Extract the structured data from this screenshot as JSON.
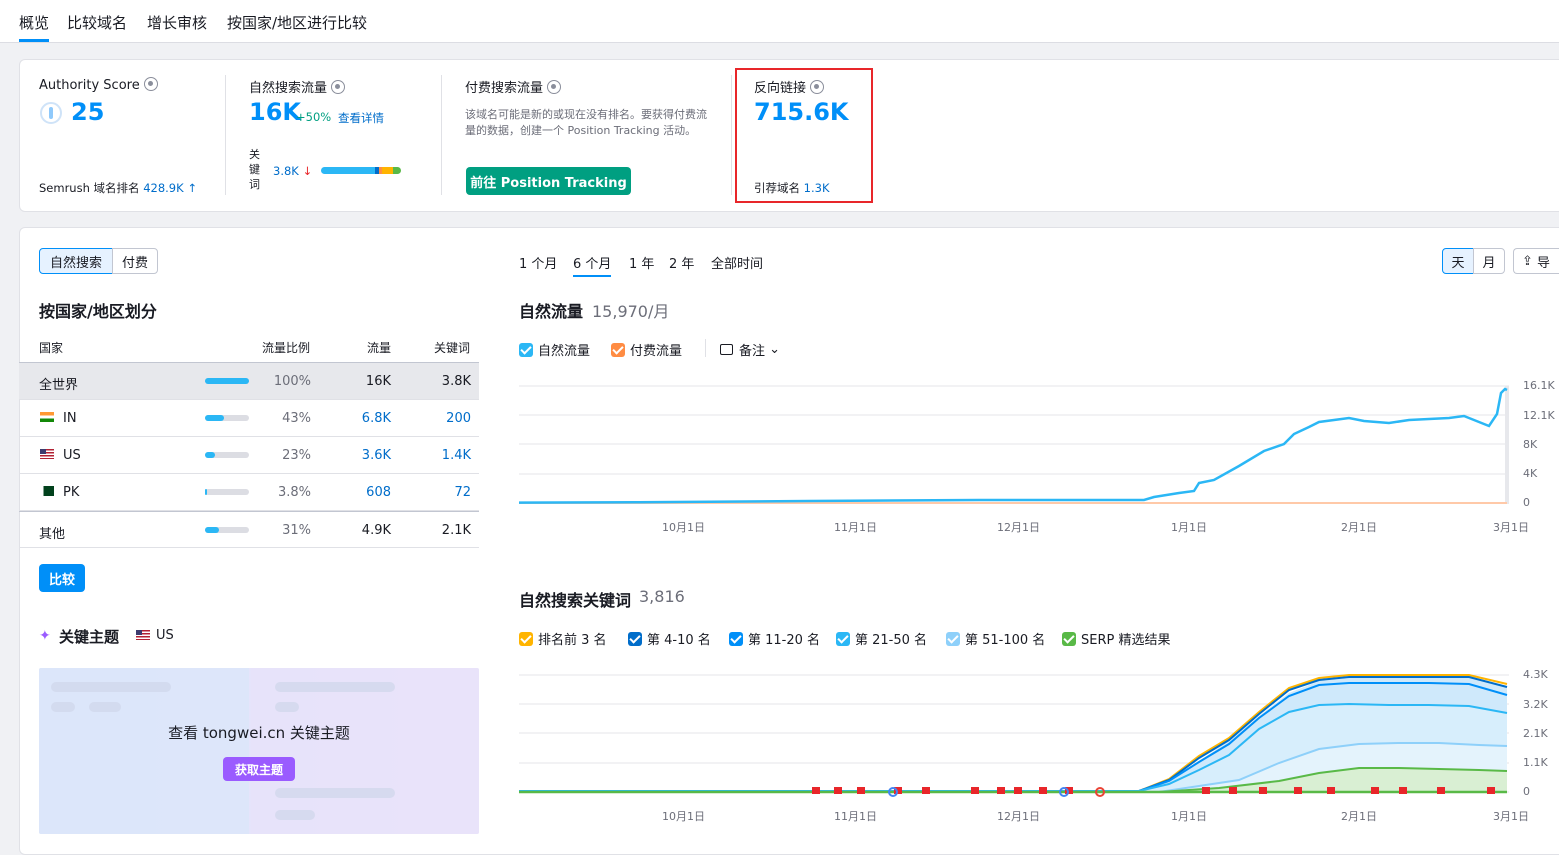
{
  "tabs": [
    "概览",
    "比较域名",
    "增长审核",
    "按国家/地区进行比较"
  ],
  "metrics": {
    "authority": {
      "label": "Authority Score",
      "value": "25",
      "rank_label": "Semrush 域名排名",
      "rank_value": "428.9K",
      "rank_arrow": "↑"
    },
    "organic": {
      "label": "自然搜索流量",
      "value": "16K",
      "change": "+50%",
      "details_link": "查看详情",
      "keywords_label": "关键词",
      "keywords_value": "3.8K",
      "keywords_arrow": "↓"
    },
    "paid": {
      "label": "付费搜索流量",
      "description": "该域名可能是新的或现在没有排名。要获得付费流量的数据，创建一个 Position Tracking 活动。",
      "button": "前往 Position Tracking"
    },
    "backlinks": {
      "label": "反向链接",
      "value": "715.6K",
      "ref_label": "引荐域名",
      "ref_value": "1.3K"
    }
  },
  "toggle": {
    "organic": "自然搜索",
    "paid": "付费"
  },
  "country_section": {
    "title": "按国家/地区划分",
    "headers": [
      "国家",
      "流量比例",
      "流量",
      "关键词"
    ],
    "rows": [
      {
        "country": "全世界",
        "share": "100%",
        "share_fraction": 1.0,
        "traffic": "16K",
        "keywords": "3.8K"
      },
      {
        "country": "IN",
        "share": "43%",
        "share_fraction": 0.43,
        "traffic": "6.8K",
        "keywords": "200"
      },
      {
        "country": "US",
        "share": "23%",
        "share_fraction": 0.23,
        "traffic": "3.6K",
        "keywords": "1.4K"
      },
      {
        "country": "PK",
        "share": "3.8%",
        "share_fraction": 0.038,
        "traffic": "608",
        "keywords": "72"
      },
      {
        "country": "其他",
        "share": "31%",
        "share_fraction": 0.31,
        "traffic": "4.9K",
        "keywords": "2.1K"
      }
    ],
    "compare_button": "比较"
  },
  "topics": {
    "title": "关键主题",
    "country": "US",
    "cta_text": "查看 tongwei.cn 关键主题",
    "cta_button": "获取主题"
  },
  "periods": [
    "1 个月",
    "6 个月",
    "1 年",
    "2 年",
    "全部时间"
  ],
  "granularity": {
    "day": "天",
    "month": "月",
    "export": "导"
  },
  "traffic_chart": {
    "title": "自然流量",
    "subtitle": "15,970/月",
    "legend": [
      {
        "label": "自然流量",
        "color": "#2bb7f5"
      },
      {
        "label": "付费流量",
        "color": "#ff8c43"
      }
    ],
    "notes": "备注",
    "y_ticks": [
      "16.1K",
      "12.1K",
      "8K",
      "4K",
      "0"
    ],
    "x_ticks": [
      "10月1日",
      "11月1日",
      "12月1日",
      "1月1日",
      "2月1日",
      "3月1日"
    ]
  },
  "keywords_chart": {
    "title": "自然搜索关键词",
    "subtitle": "3,816",
    "legend": [
      {
        "label": "排名前 3 名",
        "color": "#ffb400"
      },
      {
        "label": "第 4-10 名",
        "color": "#006dca"
      },
      {
        "label": "第 11-20 名",
        "color": "#008ff8"
      },
      {
        "label": "第 21-50 名",
        "color": "#2bb7f5"
      },
      {
        "label": "第 51-100 名",
        "color": "#8ed0fa"
      },
      {
        "label": "SERP 精选结果",
        "color": "#59b947"
      }
    ],
    "y_ticks": [
      "4.3K",
      "3.2K",
      "2.1K",
      "1.1K",
      "0"
    ],
    "x_ticks": [
      "10月1日",
      "11月1日",
      "12月1日",
      "1月1日",
      "2月1日",
      "3月1日"
    ]
  },
  "chart_data": [
    {
      "type": "line",
      "title": "自然流量",
      "x": [
        "9月1日",
        "10月1日",
        "11月1日",
        "12月1日",
        "12月20日",
        "1月1日",
        "1月5日",
        "1月15日",
        "1月25日",
        "2月1日",
        "2月15日",
        "2月25日",
        "3月1日"
      ],
      "series": [
        {
          "name": "自然流量",
          "values": [
            100,
            150,
            350,
            450,
            500,
            1500,
            3000,
            8500,
            11300,
            11100,
            11500,
            11000,
            15970
          ]
        },
        {
          "name": "付费流量",
          "values": [
            0,
            0,
            0,
            0,
            0,
            0,
            0,
            0,
            0,
            0,
            0,
            0,
            0
          ]
        }
      ],
      "ylim": [
        0,
        16100
      ]
    },
    {
      "type": "area",
      "title": "自然搜索关键词",
      "x": [
        "9月1日",
        "10月1日",
        "11月1日",
        "12月1日",
        "1月1日",
        "1月15日",
        "2月1日",
        "2月15日",
        "3月1日"
      ],
      "series": [
        {
          "name": "排名前 3 名",
          "values": [
            60,
            60,
            60,
            60,
            1900,
            3950,
            4200,
            4200,
            3816
          ]
        },
        {
          "name": "第 4-10 名",
          "values": [
            55,
            55,
            55,
            55,
            1800,
            3800,
            4050,
            4050,
            3700
          ]
        },
        {
          "name": "第 11-20 名",
          "values": [
            50,
            50,
            50,
            50,
            1650,
            3500,
            3800,
            3800,
            3550
          ]
        },
        {
          "name": "第 21-50 名",
          "values": [
            40,
            40,
            40,
            40,
            1300,
            2800,
            3150,
            3100,
            2950
          ]
        },
        {
          "name": "第 51-100 名",
          "values": [
            30,
            30,
            30,
            30,
            800,
            1600,
            1750,
            1700,
            1600
          ]
        },
        {
          "name": "SERP 精选结果",
          "values": [
            20,
            20,
            20,
            20,
            150,
            700,
            900,
            900,
            800
          ]
        }
      ],
      "ylim": [
        0,
        4300
      ]
    }
  ]
}
